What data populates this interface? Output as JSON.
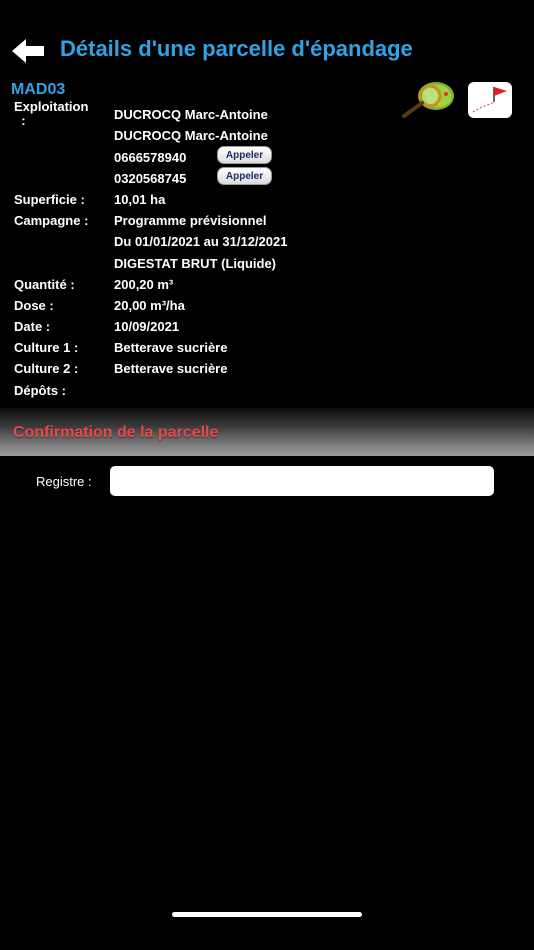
{
  "header": {
    "title": "Détails d'une parcelle d'épandage"
  },
  "parcel": {
    "id": "MAD03"
  },
  "details": {
    "exploitation_label": "Exploitation\n  :",
    "exploitation_name_1": "DUCROCQ Marc-Antoine",
    "exploitation_name_2": "DUCROCQ Marc-Antoine",
    "phone_1": "0666578940",
    "phone_2": "0320568745",
    "call_label": "Appeler",
    "superficie_label": "Superficie :",
    "superficie_value": "10,01 ha",
    "campagne_label": "Campagne :",
    "campagne_value_1": "Programme prévisionnel",
    "campagne_value_2": "Du 01/01/2021 au 31/12/2021",
    "campagne_value_3": "DIGESTAT BRUT (Liquide)",
    "quantite_label": "Quantité :",
    "quantite_value": "200,20 m³",
    "dose_label": "Dose :",
    "dose_value": "20,00 m³/ha",
    "date_label": "Date :",
    "date_value": "10/09/2021",
    "culture1_label": "Culture 1 :",
    "culture1_value": "Betterave sucrière",
    "culture2_label": "Culture 2 :",
    "culture2_value": "Betterave sucrière",
    "depots_label": "Dépôts :"
  },
  "confirmation": {
    "section_title": "Confirmation de la parcelle",
    "registre_label": "Registre :",
    "registre_value": ""
  },
  "colors": {
    "accent": "#2fa3e6",
    "section_title": "#e5484d",
    "background": "#000000"
  },
  "icons": {
    "back": "arrow-left-icon",
    "map": "map-magnifier-icon",
    "flag": "red-flag-icon"
  }
}
